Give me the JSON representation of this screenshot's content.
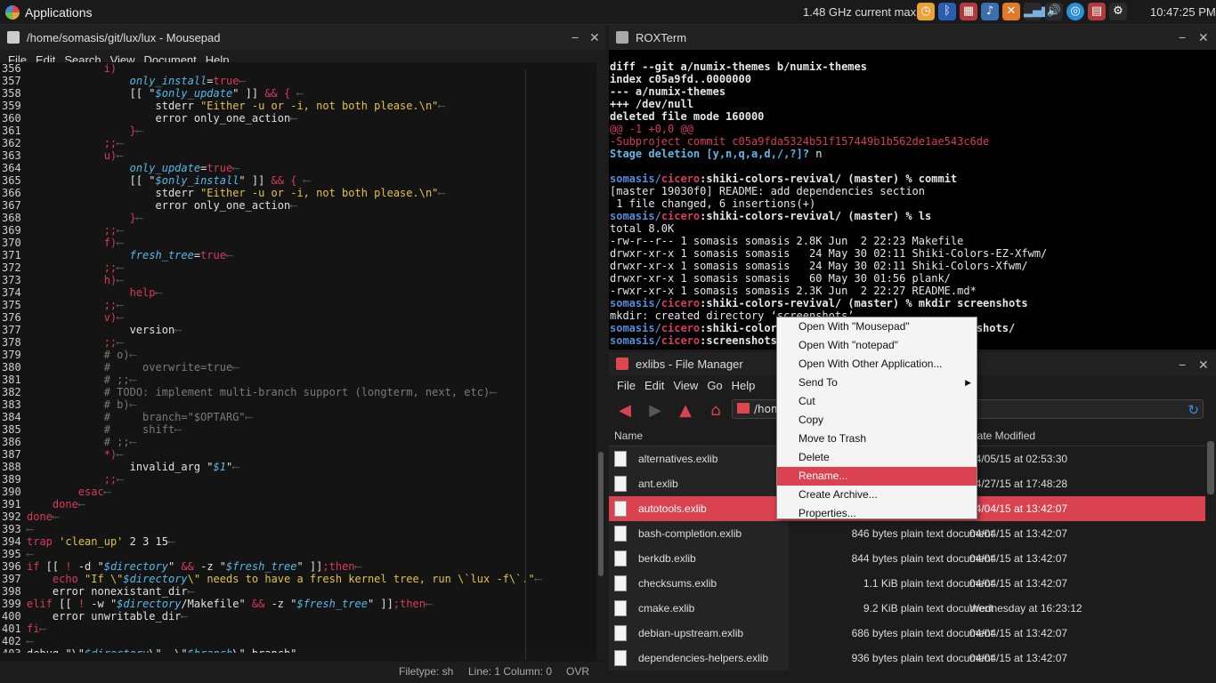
{
  "topbar": {
    "apps_label": "Applications",
    "cpu_text": "1.48 GHz current max",
    "clock": "10:47:25 PM",
    "tray_icons": [
      "clock-icon",
      "bluetooth-icon",
      "network-icon",
      "music-icon",
      "tools-icon",
      "signal-icon",
      "volume-icon",
      "browser-icon",
      "battery-icon",
      "settings-icon"
    ]
  },
  "mousepad": {
    "title": "/home/somasis/git/lux/lux - Mousepad",
    "menu": [
      "File",
      "Edit",
      "Search",
      "View",
      "Document",
      "Help"
    ],
    "status": {
      "filetype": "Filetype: sh",
      "position": "Line: 1 Column: 0",
      "mode": "OVR"
    },
    "lines": [
      {
        "n": "356",
        "html": "            <span class=\"k\">i)</span>"
      },
      {
        "n": "357",
        "html": "                <span class=\"v\">only_install</span>=<span class=\"k\">true</span><span class=\"nl\">⟵</span>"
      },
      {
        "n": "358",
        "html": "                [[ \"<span class=\"v\">$only_update</span>\" ]] <span class=\"k\">&amp;&amp;</span> <span class=\"k\">{</span> <span class=\"nl\">⟵</span>"
      },
      {
        "n": "359",
        "html": "                    stderr <span class=\"s\">\"Either -u or -i, not both please.\\n\"</span><span class=\"nl\">⟵</span>"
      },
      {
        "n": "360",
        "html": "                    error only_one_action<span class=\"nl\">⟵</span>"
      },
      {
        "n": "361",
        "html": "                <span class=\"k\">}</span><span class=\"nl\">⟵</span>"
      },
      {
        "n": "362",
        "html": "            <span class=\"k\">;;</span><span class=\"nl\">⟵</span>"
      },
      {
        "n": "363",
        "html": "            <span class=\"k\">u)</span><span class=\"nl\">⟵</span>"
      },
      {
        "n": "364",
        "html": "                <span class=\"v\">only_update</span>=<span class=\"k\">true</span><span class=\"nl\">⟵</span>"
      },
      {
        "n": "365",
        "html": "                [[ \"<span class=\"v\">$only_install</span>\" ]] <span class=\"k\">&amp;&amp;</span> <span class=\"k\">{</span> <span class=\"nl\">⟵</span>"
      },
      {
        "n": "366",
        "html": "                    stderr <span class=\"s\">\"Either -u or -i, not both please.\\n\"</span><span class=\"nl\">⟵</span>"
      },
      {
        "n": "367",
        "html": "                    error only_one_action<span class=\"nl\">⟵</span>"
      },
      {
        "n": "368",
        "html": "                <span class=\"k\">}</span><span class=\"nl\">⟵</span>"
      },
      {
        "n": "369",
        "html": "            <span class=\"k\">;;</span><span class=\"nl\">⟵</span>"
      },
      {
        "n": "370",
        "html": "            <span class=\"k\">f)</span><span class=\"nl\">⟵</span>"
      },
      {
        "n": "371",
        "html": "                <span class=\"v\">fresh_tree</span>=<span class=\"k\">true</span><span class=\"nl\">⟵</span>"
      },
      {
        "n": "372",
        "html": "            <span class=\"k\">;;</span><span class=\"nl\">⟵</span>"
      },
      {
        "n": "373",
        "html": "            <span class=\"k\">h)</span><span class=\"nl\">⟵</span>"
      },
      {
        "n": "374",
        "html": "                <span class=\"k\">help</span><span class=\"nl\">⟵</span>"
      },
      {
        "n": "375",
        "html": "            <span class=\"k\">;;</span><span class=\"nl\">⟵</span>"
      },
      {
        "n": "376",
        "html": "            <span class=\"k\">v)</span><span class=\"nl\">⟵</span>"
      },
      {
        "n": "377",
        "html": "                version<span class=\"nl\">⟵</span>"
      },
      {
        "n": "378",
        "html": "            <span class=\"k\">;;</span><span class=\"nl\">⟵</span>"
      },
      {
        "n": "379",
        "html": "            <span class=\"c\"># o)</span><span class=\"nl\">⟵</span>"
      },
      {
        "n": "380",
        "html": "            <span class=\"c\">#     overwrite=true</span><span class=\"nl\">⟵</span>"
      },
      {
        "n": "381",
        "html": "            <span class=\"c\"># ;;</span><span class=\"nl\">⟵</span>"
      },
      {
        "n": "382",
        "html": "            <span class=\"c\"># TODO: implement multi-branch support (longterm, next, etc)</span><span class=\"nl\">⟵</span>"
      },
      {
        "n": "383",
        "html": "            <span class=\"c\"># b)</span><span class=\"nl\">⟵</span>"
      },
      {
        "n": "384",
        "html": "            <span class=\"c\">#     branch=\"$OPTARG\"</span><span class=\"nl\">⟵</span>"
      },
      {
        "n": "385",
        "html": "            <span class=\"c\">#     shift</span><span class=\"nl\">⟵</span>"
      },
      {
        "n": "386",
        "html": "            <span class=\"c\"># ;;</span><span class=\"nl\">⟵</span>"
      },
      {
        "n": "387",
        "html": "            <span class=\"k\">*)</span><span class=\"nl\">⟵</span>"
      },
      {
        "n": "388",
        "html": "                invalid_arg \"<span class=\"v\">$1</span>\"<span class=\"nl\">⟵</span>"
      },
      {
        "n": "389",
        "html": "            <span class=\"k\">;;</span><span class=\"nl\">⟵</span>"
      },
      {
        "n": "390",
        "html": "        <span class=\"k\">esac</span><span class=\"nl\">⟵</span>"
      },
      {
        "n": "391",
        "html": "    <span class=\"k\">done</span><span class=\"nl\">⟵</span>"
      },
      {
        "n": "392",
        "html": "<span class=\"k\">done</span><span class=\"nl\">⟵</span>"
      },
      {
        "n": "393",
        "html": "<span class=\"nl\">⟵</span>"
      },
      {
        "n": "394",
        "html": "<span class=\"k\">trap</span> <span class=\"s\">'clean_up'</span> 2 3 15<span class=\"nl\">⟵</span>"
      },
      {
        "n": "395",
        "html": "<span class=\"nl\">⟵</span>"
      },
      {
        "n": "396",
        "html": "<span class=\"k\">if</span> [[ <span class=\"k\">!</span> -d \"<span class=\"v\">$directory</span>\" <span class=\"k\">&amp;&amp;</span> -z \"<span class=\"v\">$fresh_tree</span>\" ]]<span class=\"k\">;then</span><span class=\"nl\">⟵</span>"
      },
      {
        "n": "397",
        "html": "    <span class=\"k\">echo</span> <span class=\"s\">\"If \\\"<span class=\"v\">$directory</span>\\\" needs to have a fresh kernel tree, run \\`lux -f\\`.\"</span><span class=\"nl\">⟵</span>"
      },
      {
        "n": "398",
        "html": "    error nonexistant_dir<span class=\"nl\">⟵</span>"
      },
      {
        "n": "399",
        "html": "<span class=\"k\">elif</span> [[ <span class=\"k\">!</span> -w \"<span class=\"v\">$directory</span>/Makefile\" <span class=\"k\">&amp;&amp;</span> -z \"<span class=\"v\">$fresh_tree</span>\" ]]<span class=\"k\">;then</span><span class=\"nl\">⟵</span>"
      },
      {
        "n": "400",
        "html": "    error unwritable_dir<span class=\"nl\">⟵</span>"
      },
      {
        "n": "401",
        "html": "<span class=\"k\">fi</span><span class=\"nl\">⟵</span>"
      },
      {
        "n": "402",
        "html": "<span class=\"nl\">⟵</span>"
      },
      {
        "n": "403",
        "html": "debug \"\\\"<span class=\"v\">$directory</span>\\\", \\\"<span class=\"v\">$branch</span>\\\" branch\"<span class=\"nl\">⟵</span>"
      }
    ]
  },
  "roxterm": {
    "title": "ROXTerm",
    "lines": [
      "<span class=\"b\">diff --git a/numix-themes b/numix-themes</span>",
      "<span class=\"b\">index c05a9fd..0000000</span>",
      "<span class=\"b\">--- a/numix-themes</span>",
      "<span class=\"b\">+++ /dev/null</span>",
      "<span class=\"b\">deleted file mode 160000</span>",
      "<span class=\"tr\">@@ -1 +0,0 @@</span>",
      "<span class=\"tr\">-Subproject commit c05a9fda5324b51f157449b1b562de1ae543c6de</span>",
      "<span class=\"tc\">Stage deletion [y,n,q,a,d,/,?]?</span> n",
      "",
      "<span class=\"tp\">somasis/</span><span class=\"tr b\">cicero</span><span class=\"b\">:shiki-colors-revival/ (master) % commit</span>",
      "[master 19030f0] README: add dependencies section",
      " 1 file changed, 6 insertions(+)",
      "<span class=\"tp\">somasis/</span><span class=\"tr b\">cicero</span><span class=\"b\">:shiki-colors-revival/ (master) % ls</span>",
      "total 8.0K",
      "-rw-r--r-- 1 somasis somasis 2.8K Jun  2 22:23 Makefile",
      "drwxr-xr-x 1 somasis somasis   24 May 30 02:11 Shiki-Colors-EZ-Xfwm/",
      "drwxr-xr-x 1 somasis somasis   24 May 30 02:11 Shiki-Colors-Xfwm/",
      "drwxr-xr-x 1 somasis somasis   60 May 30 01:56 plank/",
      "-rwxr-xr-x 1 somasis somasis 2.3K Jun  2 22:27 README.md*",
      "<span class=\"tp\">somasis/</span><span class=\"tr b\">cicero</span><span class=\"b\">:shiki-colors-revival/ (master) % mkdir screenshots</span>",
      "mkdir: created directory ‘screenshots’",
      "<span class=\"tp\">somasis/</span><span class=\"tr b\">cicero</span><span class=\"b\">:shiki-colors-revival/ (master) % cd screenshots/</span>",
      "<span class=\"tp\">somasis/</span><span class=\"tr b\">cicero</span><span class=\"b\">:screenshots/ (master) %</span>"
    ]
  },
  "filemanager": {
    "title": "exlibs - File Manager",
    "menu": [
      "File",
      "Edit",
      "View",
      "Go",
      "Help"
    ],
    "path": "/home",
    "columns": {
      "name": "Name",
      "date": "Date Modified"
    },
    "rows": [
      {
        "name": "alternatives.exlib",
        "size": "",
        "date": "04/05/15 at 02:53:30",
        "selected": false
      },
      {
        "name": "ant.exlib",
        "size": "",
        "date": "04/27/15 at 17:48:28",
        "selected": false
      },
      {
        "name": "autotools.exlib",
        "size": "",
        "date": "04/04/15 at 13:42:07",
        "selected": true
      },
      {
        "name": "bash-completion.exlib",
        "size": "846 bytes plain text document",
        "date": "04/04/15 at 13:42:07",
        "selected": false
      },
      {
        "name": "berkdb.exlib",
        "size": "844 bytes plain text document",
        "date": "04/04/15 at 13:42:07",
        "selected": false
      },
      {
        "name": "checksums.exlib",
        "size": "1.1 KiB plain text document",
        "date": "04/04/15 at 13:42:07",
        "selected": false
      },
      {
        "name": "cmake.exlib",
        "size": "9.2 KiB plain text document",
        "date": "Wednesday at 16:23:12",
        "selected": false
      },
      {
        "name": "debian-upstream.exlib",
        "size": "686 bytes plain text document",
        "date": "04/04/15 at 13:42:07",
        "selected": false
      },
      {
        "name": "dependencies-helpers.exlib",
        "size": "936 bytes plain text document",
        "date": "04/04/15 at 13:42:07",
        "selected": false
      }
    ]
  },
  "context_menu": {
    "items": [
      {
        "label": "Open With \"Mousepad\"",
        "highlight": false,
        "submenu": false
      },
      {
        "label": "Open With \"notepad\"",
        "highlight": false,
        "submenu": false
      },
      {
        "label": "Open With Other Application...",
        "highlight": false,
        "submenu": false
      },
      {
        "label": "Send To",
        "highlight": false,
        "submenu": true
      },
      {
        "label": "Cut",
        "highlight": false,
        "submenu": false
      },
      {
        "label": "Copy",
        "highlight": false,
        "submenu": false
      },
      {
        "label": "Move to Trash",
        "highlight": false,
        "submenu": false
      },
      {
        "label": "Delete",
        "highlight": false,
        "submenu": false
      },
      {
        "label": "Rename...",
        "highlight": true,
        "submenu": false
      },
      {
        "label": "Create Archive...",
        "highlight": false,
        "submenu": false
      },
      {
        "label": "Properties...",
        "highlight": false,
        "submenu": false
      }
    ]
  }
}
